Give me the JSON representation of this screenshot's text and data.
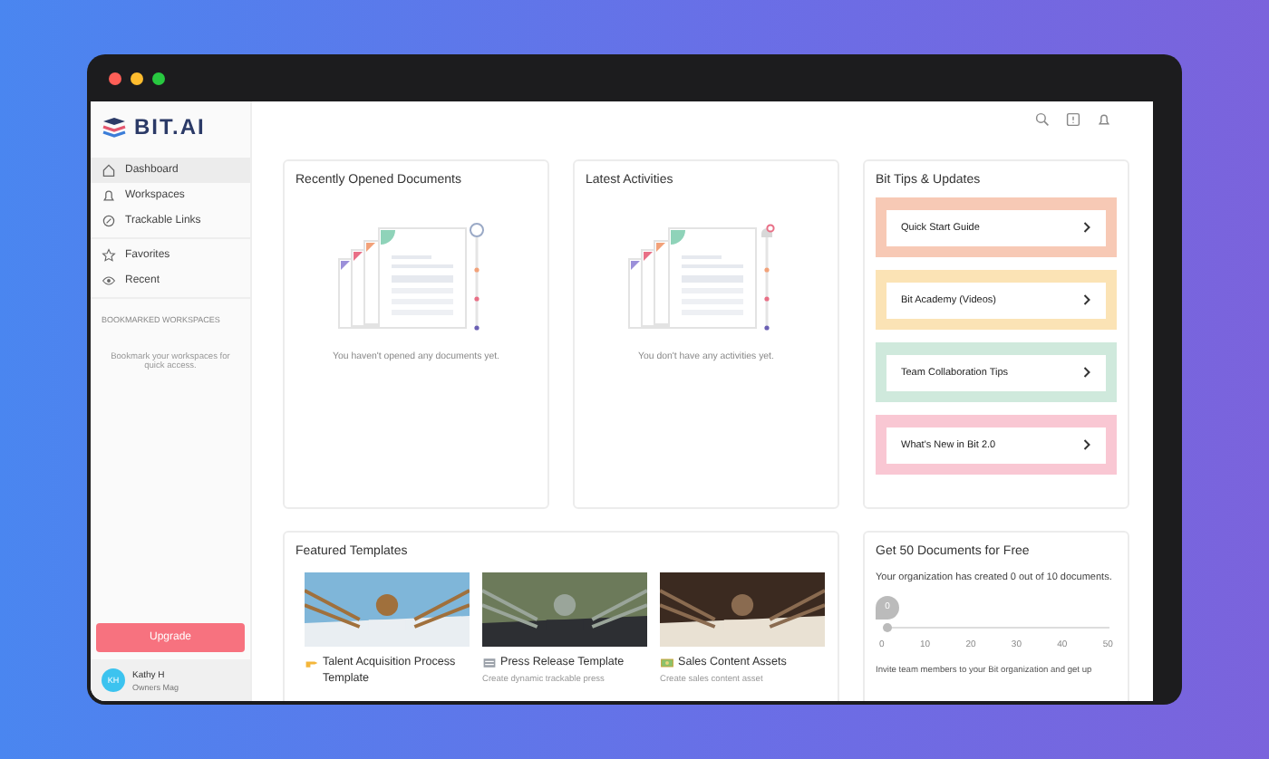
{
  "window_controls": [
    {
      "color": "#ff5f57"
    },
    {
      "color": "#febc2e"
    },
    {
      "color": "#28c840"
    }
  ],
  "sidebar": {
    "logo": "BIT.AI",
    "nav": [
      {
        "label": "Dashboard",
        "selected": true
      },
      {
        "label": "Workspaces",
        "selected": false
      },
      {
        "label": "Trackable Links",
        "selected": false
      }
    ],
    "nav2": [
      {
        "label": "Favorites",
        "selected": false
      },
      {
        "label": "Recent",
        "selected": false
      }
    ],
    "bookmarks_heading": "BOOKMARKED WORKSPACES",
    "bookmarks_hint": "Bookmark your workspaces for quick access.",
    "upgrade_button": "Upgrade",
    "user": {
      "initials": "KH",
      "name": "Kathy H",
      "workspace": "Owners Mag"
    }
  },
  "recent_documents": {
    "title": "Recently Opened Documents",
    "empty_text": "You haven't opened any documents yet."
  },
  "latest_activities": {
    "title": "Latest Activities",
    "empty_text": "You don't have any activities yet."
  },
  "tips": {
    "title": "Bit Tips & Updates",
    "items": [
      {
        "label": "Quick Start Guide",
        "color": "#f7c9b5"
      },
      {
        "label": "Bit Academy (Videos)",
        "color": "#fbe3b5"
      },
      {
        "label": "Team Collaboration Tips",
        "color": "#cfe9dc"
      },
      {
        "label": "What's New in Bit 2.0",
        "color": "#f9c7d3"
      }
    ]
  },
  "featured_templates": {
    "title": "Featured Templates",
    "items": [
      {
        "title": "Talent Acquisition Process Template"
      },
      {
        "title": "Press Release Template",
        "description": "Create dynamic trackable press"
      },
      {
        "title": "Sales Content Assets",
        "description": "Create sales content asset"
      }
    ]
  },
  "free_documents": {
    "title": "Get 50 Documents for Free",
    "text": "Your organization has created 0 out of 10 documents.",
    "slider": {
      "level": 0,
      "reading": "0"
    },
    "ticks": [
      "0",
      "10",
      "20",
      "30",
      "40",
      "50"
    ],
    "invite_text": "Invite team members to your Bit organization and get up"
  }
}
